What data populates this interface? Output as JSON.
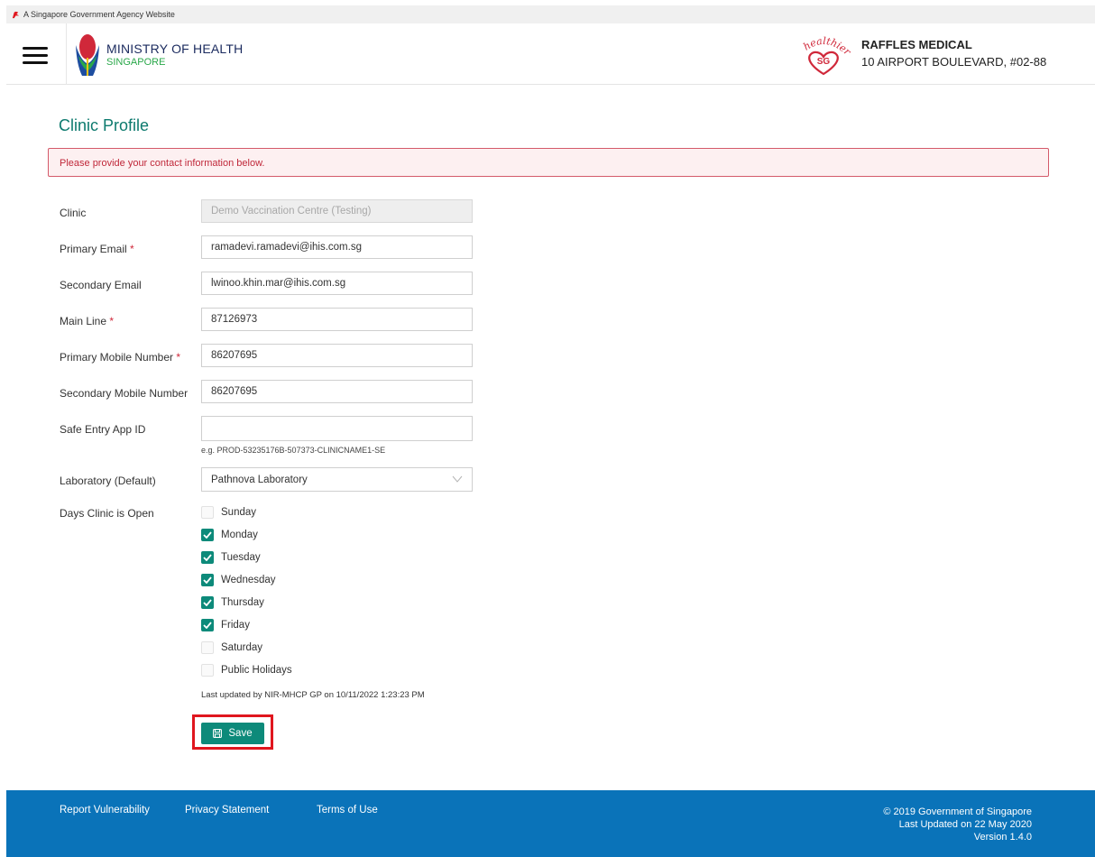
{
  "gov_banner": {
    "text": "A Singapore Government Agency Website"
  },
  "header": {
    "ministry_title": "MINISTRY OF HEALTH",
    "ministry_subtitle": "SINGAPORE",
    "partner_logo_text": "healthier",
    "partner_logo_sg": "SG",
    "clinic_name": "RAFFLES MEDICAL",
    "clinic_address": "10 AIRPORT BOULEVARD, #02-88"
  },
  "page_title": "Clinic Profile",
  "alert_message": "Please provide your contact information below.",
  "form": {
    "required_marker": "*",
    "clinic": {
      "label": "Clinic",
      "value": "Demo Vaccination Centre (Testing)"
    },
    "primary_email": {
      "label": "Primary Email",
      "value": "ramadevi.ramadevi@ihis.com.sg"
    },
    "secondary_email": {
      "label": "Secondary Email",
      "value": "lwinoo.khin.mar@ihis.com.sg"
    },
    "main_line": {
      "label": "Main Line",
      "value": "87126973"
    },
    "primary_mobile": {
      "label": "Primary Mobile Number",
      "value": "86207695"
    },
    "secondary_mobile": {
      "label": "Secondary Mobile Number",
      "value": "86207695"
    },
    "safe_entry": {
      "label": "Safe Entry App ID",
      "value": "",
      "hint": "e.g. PROD-53235176B-507373-CLINICNAME1-SE"
    },
    "laboratory": {
      "label": "Laboratory (Default)",
      "selected": "Pathnova Laboratory"
    },
    "days_open": {
      "label": "Days Clinic is Open",
      "days": [
        {
          "label": "Sunday",
          "checked": false
        },
        {
          "label": "Monday",
          "checked": true
        },
        {
          "label": "Tuesday",
          "checked": true
        },
        {
          "label": "Wednesday",
          "checked": true
        },
        {
          "label": "Thursday",
          "checked": true
        },
        {
          "label": "Friday",
          "checked": true
        },
        {
          "label": "Saturday",
          "checked": false
        },
        {
          "label": "Public Holidays",
          "checked": false
        }
      ]
    },
    "last_updated": "Last updated by NIR-MHCP GP on 10/11/2022 1:23:23 PM",
    "save_label": "Save"
  },
  "footer": {
    "links": [
      "Report Vulnerability",
      "Privacy Statement",
      "Terms of Use"
    ],
    "copyright": "© 2019 Government of Singapore",
    "last_updated": "Last Updated on 22 May 2020",
    "version": "Version 1.4.0"
  },
  "colors": {
    "accent": "#0d8a7a",
    "title": "#0d7a6e",
    "alert_border": "#d45a6a",
    "alert_text": "#c0283a",
    "footer": "#0a73b9",
    "highlight": "#e0161e"
  }
}
